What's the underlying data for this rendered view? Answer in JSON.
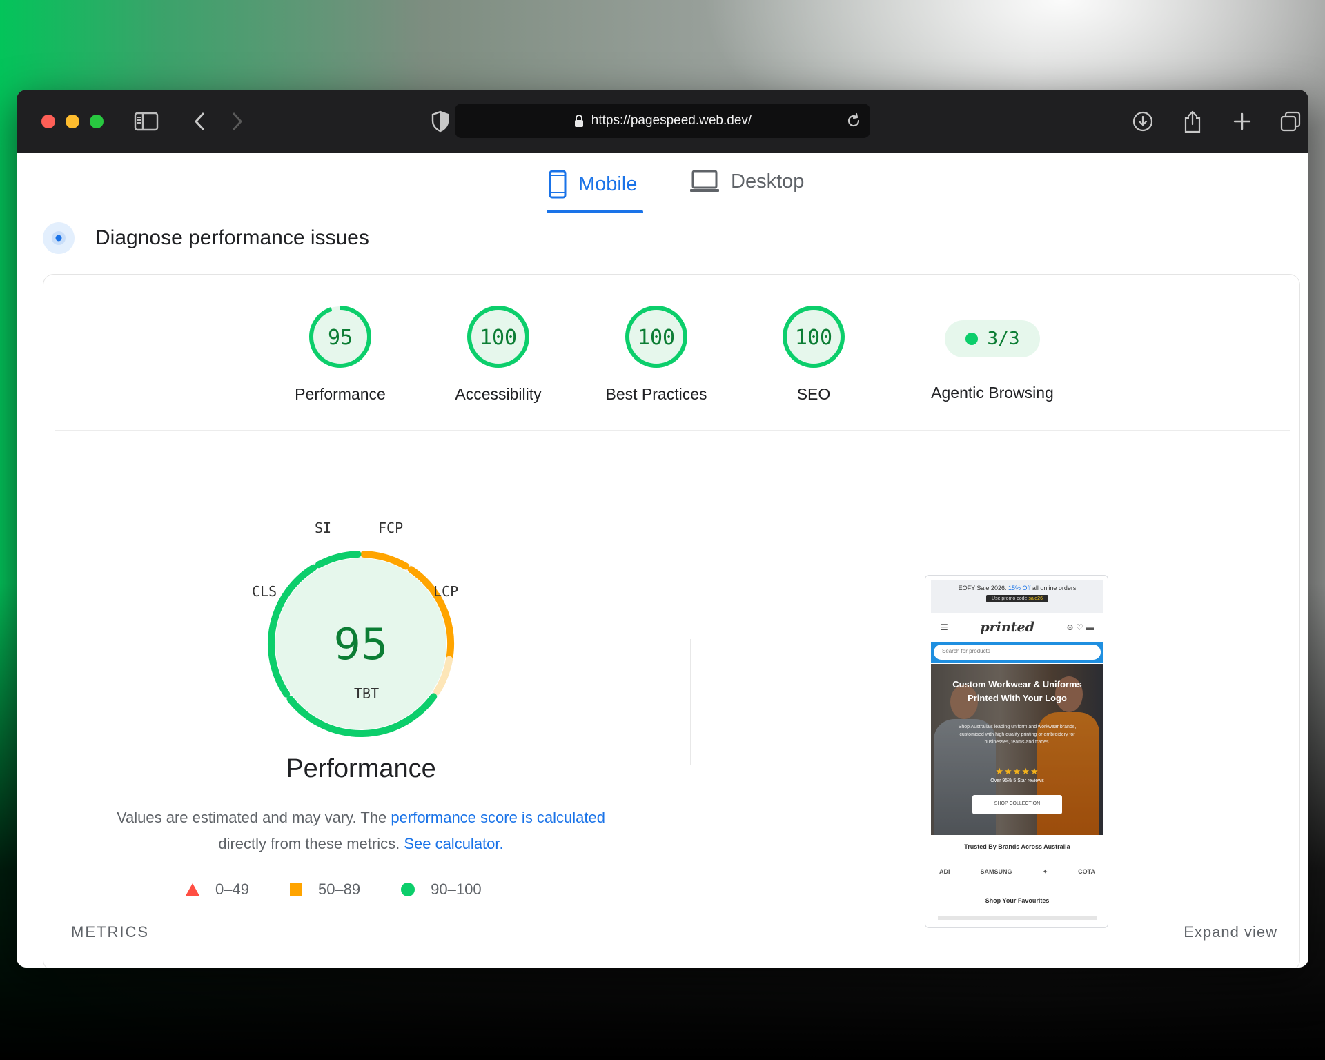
{
  "browser": {
    "url": "https://pagespeed.web.dev/"
  },
  "tabs": {
    "mobile": "Mobile",
    "desktop": "Desktop",
    "active": "Mobile"
  },
  "section_title": "Diagnose performance issues",
  "scores": [
    {
      "label": "Performance",
      "value": "95",
      "fraction": 0.95
    },
    {
      "label": "Accessibility",
      "value": "100",
      "fraction": 1.0
    },
    {
      "label": "Best Practices",
      "value": "100",
      "fraction": 1.0
    },
    {
      "label": "SEO",
      "value": "100",
      "fraction": 1.0
    }
  ],
  "agentic": {
    "label": "Agentic Browsing",
    "value": "3/3"
  },
  "performance_gauge": {
    "score": "95",
    "title": "Performance",
    "labels": {
      "si": "SI",
      "fcp": "FCP",
      "lcp": "LCP",
      "tbt": "TBT",
      "cls": "CLS"
    }
  },
  "note": {
    "text1": "Values are estimated and may vary. The ",
    "link1": "performance score is calculated",
    "text2": "directly from these metrics. ",
    "link2": "See calculator."
  },
  "legend": {
    "poor": "0–49",
    "average": "50–89",
    "good": "90–100"
  },
  "colors": {
    "good": "#0cce6b",
    "average": "#ffa400",
    "poor": "#ff4e42",
    "accent": "#1a73e8"
  },
  "screenshot": {
    "banner": "EOFY Sale 2026:",
    "banner_offer": "15% Off",
    "banner_rest": "all online orders",
    "promo_prefix": "Use promo code",
    "promo_code": "sale26",
    "logo": "printed",
    "search_placeholder": "Search for products",
    "hero_title": "Custom Workwear & Uniforms Printed With Your Logo",
    "hero_sub": "Shop Australia's leading uniform and workwear brands, customised with high quality printing or embroidery for businesses, teams and trades.",
    "stars": "★★★★★",
    "reviews": "Over 95% 5 Star reviews",
    "cta": "SHOP COLLECTION",
    "trusted": "Trusted By Brands Across Australia",
    "brands": [
      "ADI",
      "SAMSUNG",
      "✦",
      "COTA"
    ],
    "favourites": "Shop Your Favourites"
  },
  "footer": {
    "metrics": "METRICS",
    "expand": "Expand view"
  }
}
